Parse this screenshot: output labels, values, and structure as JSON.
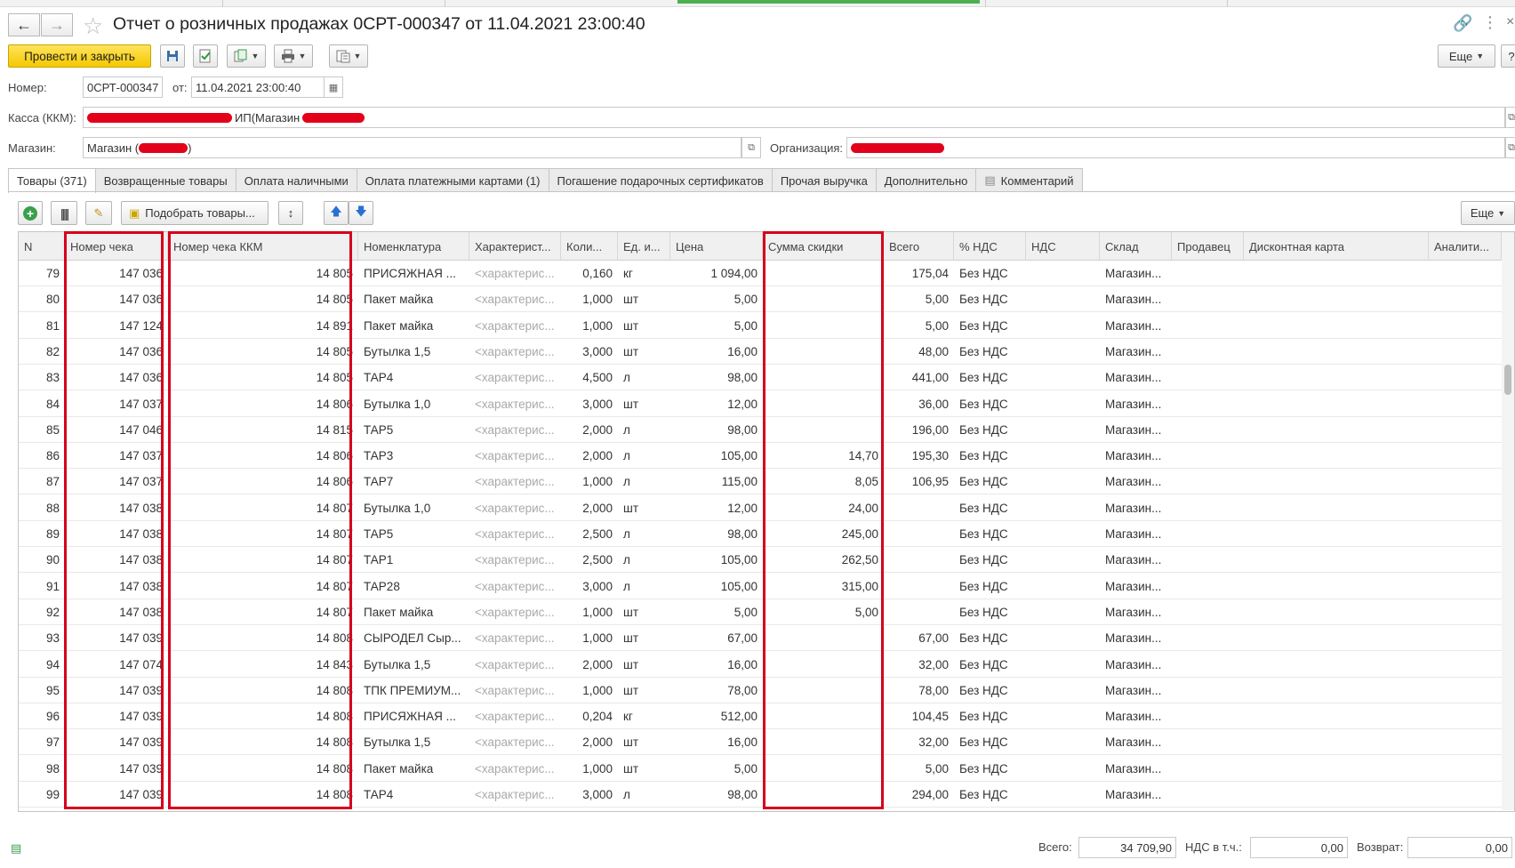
{
  "window": {
    "title": "Отчет о розничных продажах 0СРТ-000347 от 11.04.2021 23:00:40"
  },
  "toolbar": {
    "post_and_close": "Провести и закрыть",
    "more": "Еще"
  },
  "form": {
    "number_label": "Номер:",
    "number_value": "0СРТ-000347",
    "date_label": "от:",
    "date_value": "11.04.2021 23:00:40",
    "kassa_label": "Касса (ККМ):",
    "kassa_value": "ИП(Магазин",
    "shop_label": "Магазин:",
    "shop_value_prefix": "Магазин (",
    "shop_value_suffix": ")",
    "org_label": "Организация:"
  },
  "tabs": [
    {
      "label": "Товары (371)",
      "active": true
    },
    {
      "label": "Возвращенные товары"
    },
    {
      "label": "Оплата наличными"
    },
    {
      "label": "Оплата платежными картами (1)"
    },
    {
      "label": "Погашение подарочных сертификатов"
    },
    {
      "label": "Прочая выручка"
    },
    {
      "label": "Дополнительно"
    },
    {
      "label": "Комментарий"
    }
  ],
  "table_toolbar": {
    "pick_goods": "Подобрать товары...",
    "more": "Еще"
  },
  "table": {
    "columns": [
      "N",
      "Номер чека",
      "Номер чека ККМ",
      "Номенклатура",
      "Характерист...",
      "Коли...",
      "Ед. и...",
      "Цена",
      "Сумма скидки",
      "Всего",
      "% НДС",
      "НДС",
      "Склад",
      "Продавец",
      "Дисконтная карта",
      "Аналити..."
    ],
    "placeholder": "<характерис...",
    "rows": [
      [
        "79",
        "147 036",
        "14 805",
        "ПРИСЯЖНАЯ ...",
        "0,160",
        "кг",
        "1 094,00",
        "",
        "175,04",
        "Без НДС",
        "Магазин..."
      ],
      [
        "80",
        "147 036",
        "14 805",
        "Пакет майка",
        "1,000",
        "шт",
        "5,00",
        "",
        "5,00",
        "Без НДС",
        "Магазин..."
      ],
      [
        "81",
        "147 124",
        "14 891",
        "Пакет майка",
        "1,000",
        "шт",
        "5,00",
        "",
        "5,00",
        "Без НДС",
        "Магазин..."
      ],
      [
        "82",
        "147 036",
        "14 805",
        "Бутылка 1,5",
        "3,000",
        "шт",
        "16,00",
        "",
        "48,00",
        "Без НДС",
        "Магазин..."
      ],
      [
        "83",
        "147 036",
        "14 805",
        "ТАР4",
        "4,500",
        "л",
        "98,00",
        "",
        "441,00",
        "Без НДС",
        "Магазин..."
      ],
      [
        "84",
        "147 037",
        "14 806",
        "Бутылка 1,0",
        "3,000",
        "шт",
        "12,00",
        "",
        "36,00",
        "Без НДС",
        "Магазин..."
      ],
      [
        "85",
        "147 046",
        "14 815",
        "ТАР5",
        "2,000",
        "л",
        "98,00",
        "",
        "196,00",
        "Без НДС",
        "Магазин..."
      ],
      [
        "86",
        "147 037",
        "14 806",
        "ТАР3",
        "2,000",
        "л",
        "105,00",
        "14,70",
        "195,30",
        "Без НДС",
        "Магазин..."
      ],
      [
        "87",
        "147 037",
        "14 806",
        "ТАР7",
        "1,000",
        "л",
        "115,00",
        "8,05",
        "106,95",
        "Без НДС",
        "Магазин..."
      ],
      [
        "88",
        "147 038",
        "14 807",
        "Бутылка 1,0",
        "2,000",
        "шт",
        "12,00",
        "24,00",
        "",
        "Без НДС",
        "Магазин..."
      ],
      [
        "89",
        "147 038",
        "14 807",
        "ТАР5",
        "2,500",
        "л",
        "98,00",
        "245,00",
        "",
        "Без НДС",
        "Магазин..."
      ],
      [
        "90",
        "147 038",
        "14 807",
        "ТАР1",
        "2,500",
        "л",
        "105,00",
        "262,50",
        "",
        "Без НДС",
        "Магазин..."
      ],
      [
        "91",
        "147 038",
        "14 807",
        "ТАР28",
        "3,000",
        "л",
        "105,00",
        "315,00",
        "",
        "Без НДС",
        "Магазин..."
      ],
      [
        "92",
        "147 038",
        "14 807",
        "Пакет майка",
        "1,000",
        "шт",
        "5,00",
        "5,00",
        "",
        "Без НДС",
        "Магазин..."
      ],
      [
        "93",
        "147 039",
        "14 808",
        "СЫРОДЕЛ Сыр...",
        "1,000",
        "шт",
        "67,00",
        "",
        "67,00",
        "Без НДС",
        "Магазин..."
      ],
      [
        "94",
        "147 074",
        "14 843",
        "Бутылка 1,5",
        "2,000",
        "шт",
        "16,00",
        "",
        "32,00",
        "Без НДС",
        "Магазин..."
      ],
      [
        "95",
        "147 039",
        "14 808",
        "ТПК ПРЕМИУМ...",
        "1,000",
        "шт",
        "78,00",
        "",
        "78,00",
        "Без НДС",
        "Магазин..."
      ],
      [
        "96",
        "147 039",
        "14 808",
        "ПРИСЯЖНАЯ ...",
        "0,204",
        "кг",
        "512,00",
        "",
        "104,45",
        "Без НДС",
        "Магазин..."
      ],
      [
        "97",
        "147 039",
        "14 808",
        "Бутылка 1,5",
        "2,000",
        "шт",
        "16,00",
        "",
        "32,00",
        "Без НДС",
        "Магазин..."
      ],
      [
        "98",
        "147 039",
        "14 808",
        "Пакет майка",
        "1,000",
        "шт",
        "5,00",
        "",
        "5,00",
        "Без НДС",
        "Магазин..."
      ],
      [
        "99",
        "147 039",
        "14 808",
        "ТАР4",
        "3,000",
        "л",
        "98,00",
        "",
        "294,00",
        "Без НДС",
        "Магазин..."
      ]
    ]
  },
  "footer": {
    "total_label": "Всего:",
    "total_value": "34 709,90",
    "vat_label": "НДС в т.ч.:",
    "vat_value": "0,00",
    "return_label": "Возврат:",
    "return_value": "0,00"
  },
  "colors": {
    "primary_button": "#f5c800",
    "highlight_box": "#d6001c",
    "redaction": "#e3001b"
  }
}
